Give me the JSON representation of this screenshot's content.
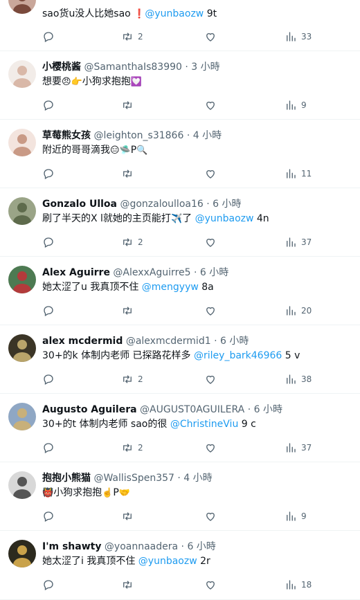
{
  "tweets": [
    {
      "name": "",
      "handle": "",
      "time": "",
      "parts": [
        {
          "t": "sao货u没人比她sao "
        },
        {
          "t": "❗",
          "e": 1
        },
        {
          "t": "@yunbaozw",
          "m": 1
        },
        {
          "t": " 9t"
        }
      ],
      "retweets": "2",
      "views": "33",
      "avatar": {
        "bg": "#c9a79a",
        "fg": "#7a4a3c"
      }
    },
    {
      "name": "小樱桃酱",
      "handle": "@SamanthaIs83990",
      "time": "3 小時",
      "parts": [
        {
          "t": "想要"
        },
        {
          "t": "😠👉",
          "e": 1
        },
        {
          "t": "小狗求抱抱"
        },
        {
          "t": "💟",
          "e": 1
        }
      ],
      "retweets": "",
      "views": "9",
      "avatar": {
        "bg": "#f2ece8",
        "fg": "#d9b8a8"
      }
    },
    {
      "name": "草莓熊女孩",
      "handle": "@leighton_s31866",
      "time": "4 小時",
      "parts": [
        {
          "t": "附近的哥哥滴我"
        },
        {
          "t": "😑🛸",
          "e": 1
        },
        {
          "t": "P"
        },
        {
          "t": "🔍",
          "e": 1
        }
      ],
      "retweets": "",
      "views": "11",
      "avatar": {
        "bg": "#f3e4de",
        "fg": "#c99a86"
      }
    },
    {
      "name": "Gonzalo Ulloa",
      "handle": "@gonzaloulloa16",
      "time": "6 小時",
      "parts": [
        {
          "t": "刷了半天的X l就她的主页能打"
        },
        {
          "t": "✈️",
          "e": 1
        },
        {
          "t": "了 "
        },
        {
          "t": "@yunbaozw",
          "m": 1
        },
        {
          "t": " 4n"
        }
      ],
      "retweets": "2",
      "views": "37",
      "avatar": {
        "bg": "#9aa487",
        "fg": "#5e6b4c"
      }
    },
    {
      "name": "Alex Aguirre",
      "handle": "@AlexxAguirre5",
      "time": "6 小時",
      "parts": [
        {
          "t": "她太涩了u 我真顶不住 "
        },
        {
          "t": "@mengyyw",
          "m": 1
        },
        {
          "t": " 8a"
        }
      ],
      "retweets": "",
      "views": "20",
      "avatar": {
        "bg": "#4d7a52",
        "fg": "#b33b3b"
      }
    },
    {
      "name": "alex mcdermid",
      "handle": "@alexmcdermid1",
      "time": "6 小時",
      "parts": [
        {
          "t": "30+的k 体制内老师 已探路花样多 "
        },
        {
          "t": "@riley_bark46966",
          "m": 1
        },
        {
          "t": " 5 v"
        }
      ],
      "retweets": "2",
      "views": "38",
      "avatar": {
        "bg": "#3b3526",
        "fg": "#b9a46a"
      }
    },
    {
      "name": "Augusto Aguilera",
      "handle": "@AUGUST0AGUILERA",
      "time": "6 小時",
      "parts": [
        {
          "t": "30+的t 体制内老师 sao的很 "
        },
        {
          "t": "@ChristineViu",
          "m": 1
        },
        {
          "t": " 9 c"
        }
      ],
      "retweets": "2",
      "views": "37",
      "avatar": {
        "bg": "#8fa7c4",
        "fg": "#c8b07a"
      }
    },
    {
      "name": "抱抱小熊猫",
      "handle": "@WallisSpen357",
      "time": "4 小時",
      "parts": [
        {
          "t": "👹",
          "e": 1
        },
        {
          "t": "小狗求抱抱"
        },
        {
          "t": "☝️",
          "e": 1
        },
        {
          "t": "P"
        },
        {
          "t": "🤝",
          "e": 1
        }
      ],
      "retweets": "",
      "views": "9",
      "avatar": {
        "bg": "#d8d8d8",
        "fg": "#555555"
      }
    },
    {
      "name": "I'm shawty",
      "handle": "@yoannaadera",
      "time": "6 小時",
      "parts": [
        {
          "t": "她太涩了i 我真顶不住 "
        },
        {
          "t": "@yunbaozw",
          "m": 1
        },
        {
          "t": " 2r"
        }
      ],
      "retweets": "",
      "views": "18",
      "avatar": {
        "bg": "#2c2a1e",
        "fg": "#c9a24a"
      }
    }
  ],
  "colors": {
    "link": "#1d9bf0",
    "muted": "#536471",
    "divider": "#eff3f4"
  }
}
